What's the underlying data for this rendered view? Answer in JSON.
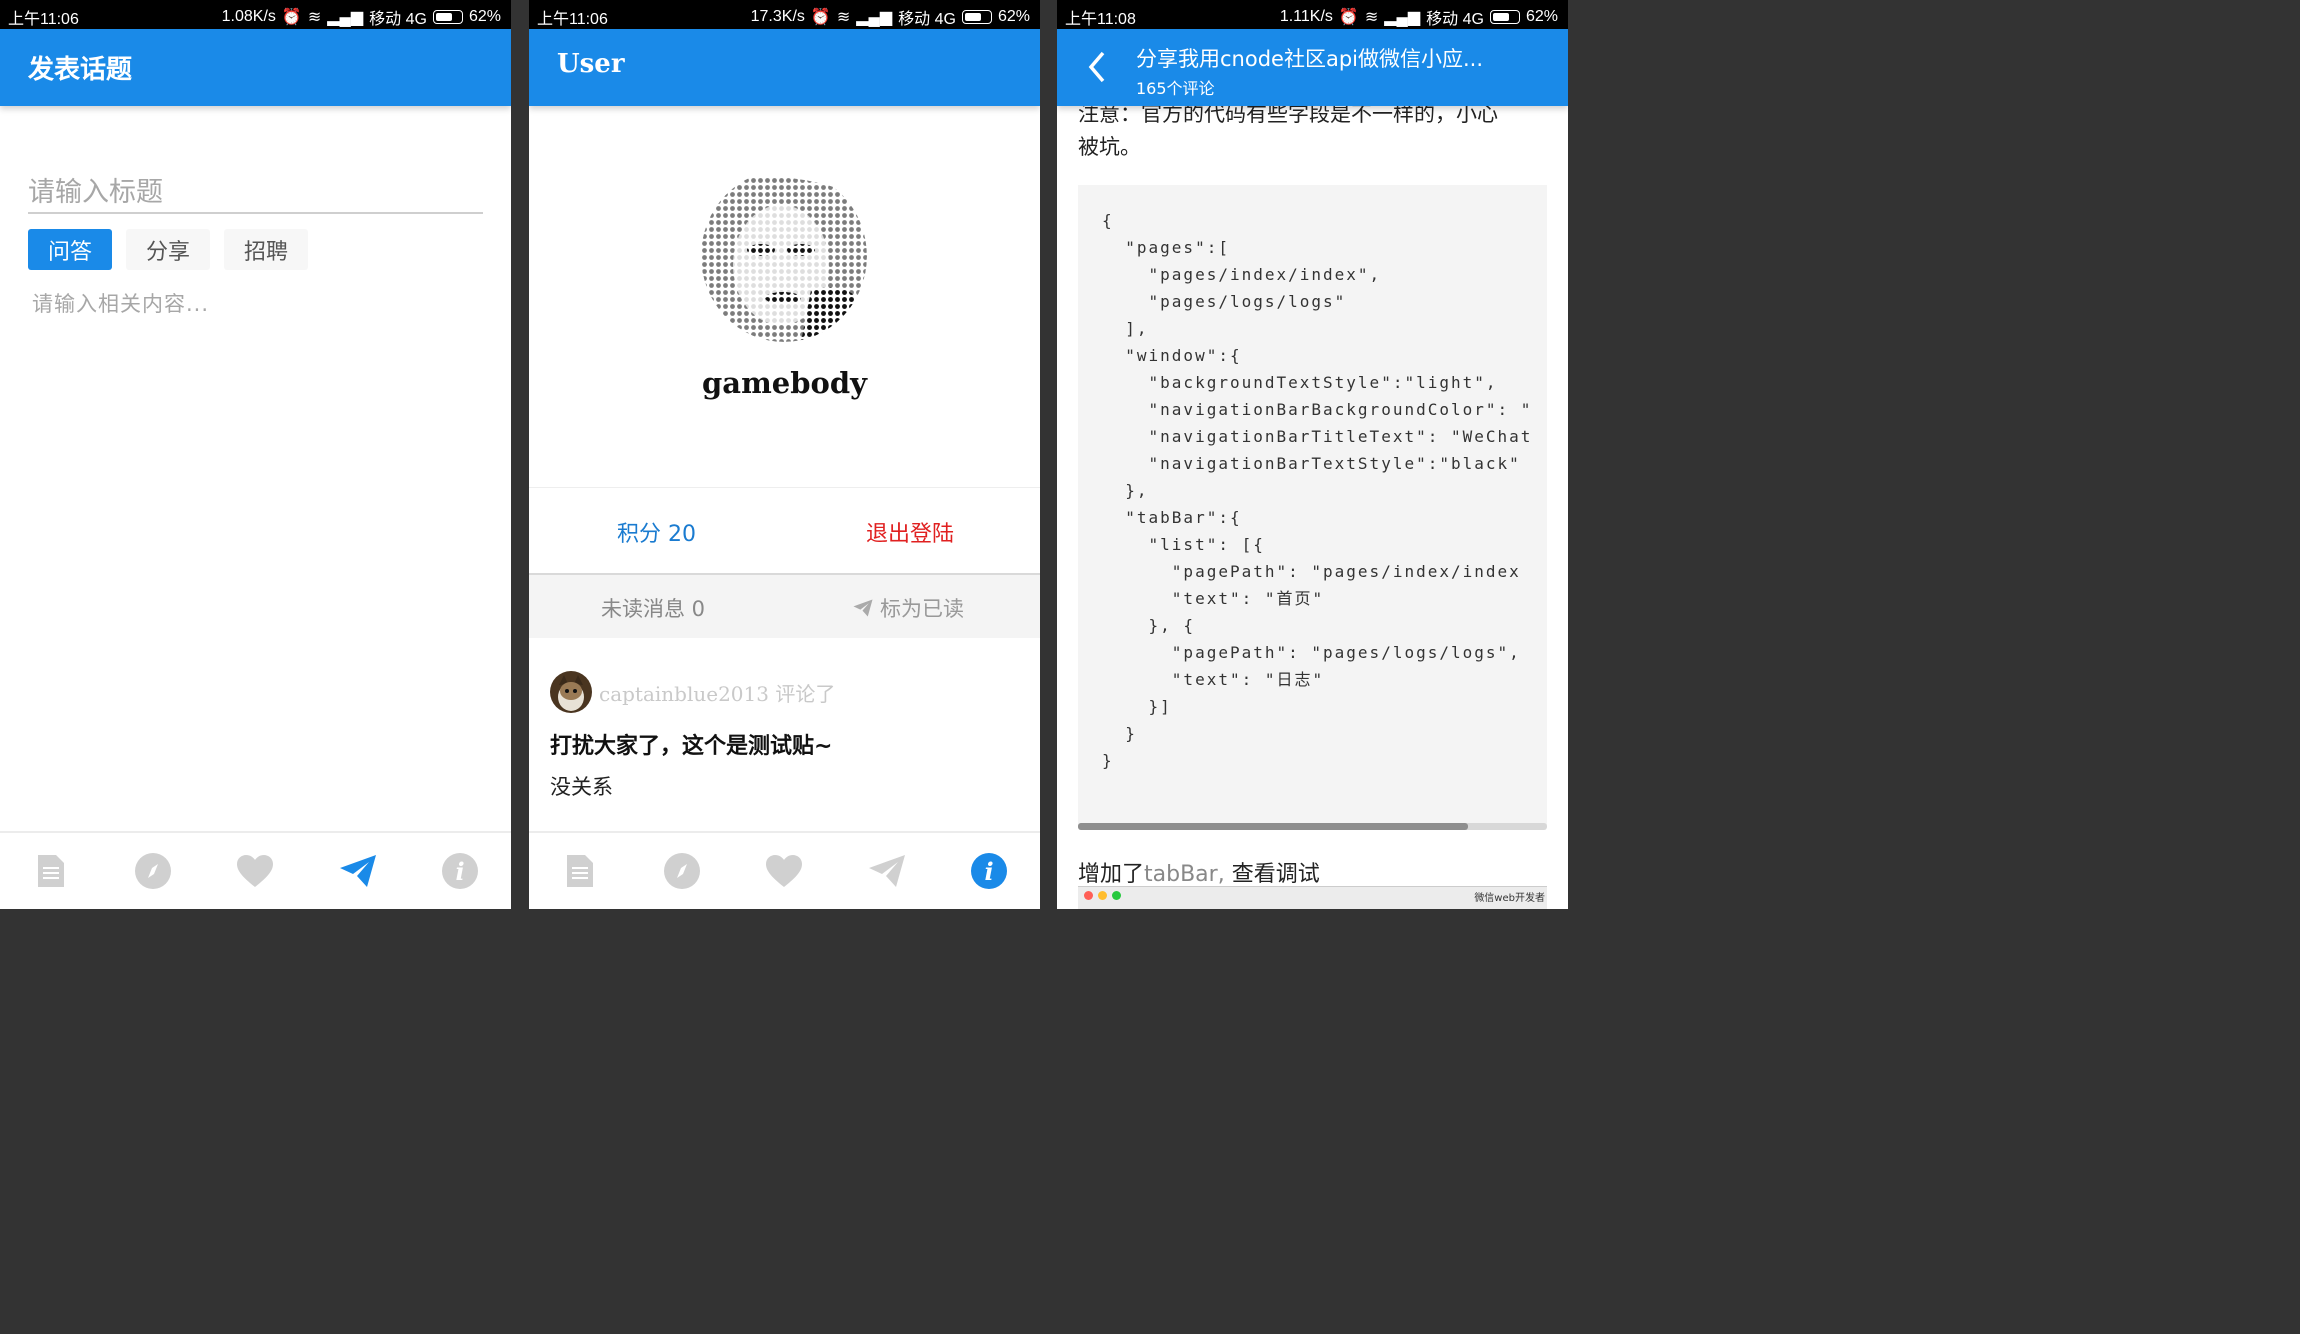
{
  "screen1": {
    "status": {
      "time": "上午11:06",
      "speed": "1.08K/s",
      "carrier": "移动 4G",
      "battery": "62%"
    },
    "header_title": "发表话题",
    "title_placeholder": "请输入标题",
    "tags": [
      "问答",
      "分享",
      "招聘"
    ],
    "content_placeholder": "请输入相关内容..."
  },
  "screen2": {
    "status": {
      "time": "上午11:06",
      "speed": "17.3K/s",
      "carrier": "移动 4G",
      "battery": "62%"
    },
    "header_title": "User",
    "username": "gamebody",
    "score_label": "积分 20",
    "logout_label": "退出登陆",
    "unread_label": "未读消息 0",
    "mark_read_label": "标为已读",
    "feed": {
      "user_action": "captainblue2013 评论了",
      "title": "打扰大家了，这个是测试贴~",
      "body": "没关系"
    }
  },
  "screen3": {
    "status": {
      "time": "上午11:08",
      "speed": "1.11K/s",
      "carrier": "移动 4G",
      "battery": "62%"
    },
    "header_title": "分享我用cnode社区api做微信小应...",
    "header_subtitle": "165个评论",
    "partial_line": "注意：官方的代码有些字段是不一样的，小心",
    "paragraph": "被坑。",
    "code": "{\n  \"pages\":[\n    \"pages/index/index\",\n    \"pages/logs/logs\"\n  ],\n  \"window\":{\n    \"backgroundTextStyle\":\"light\",\n    \"navigationBarBackgroundColor\": \"\n    \"navigationBarTitleText\": \"WeChat\n    \"navigationBarTextStyle\":\"black\"\n  },\n  \"tabBar\":{\n    \"list\": [{\n      \"pagePath\": \"pages/index/index\n      \"text\": \"首页\"\n    }, {\n      \"pagePath\": \"pages/logs/logs\",\n      \"text\": \"日志\"\n    }]\n  }\n}",
    "caption_prefix": "增加了",
    "caption_highlight": "tabBar,",
    "caption_suffix": " 查看调试",
    "screenshot_title": "微信web开发者"
  },
  "tabbar": {
    "icons": [
      "document-icon",
      "compass-icon",
      "heart-icon",
      "send-icon",
      "info-icon"
    ]
  },
  "colors": {
    "primary": "#1a8ae8",
    "danger": "#e02020",
    "link": "#1a7bd0",
    "inactive": "#d0d0d0"
  }
}
